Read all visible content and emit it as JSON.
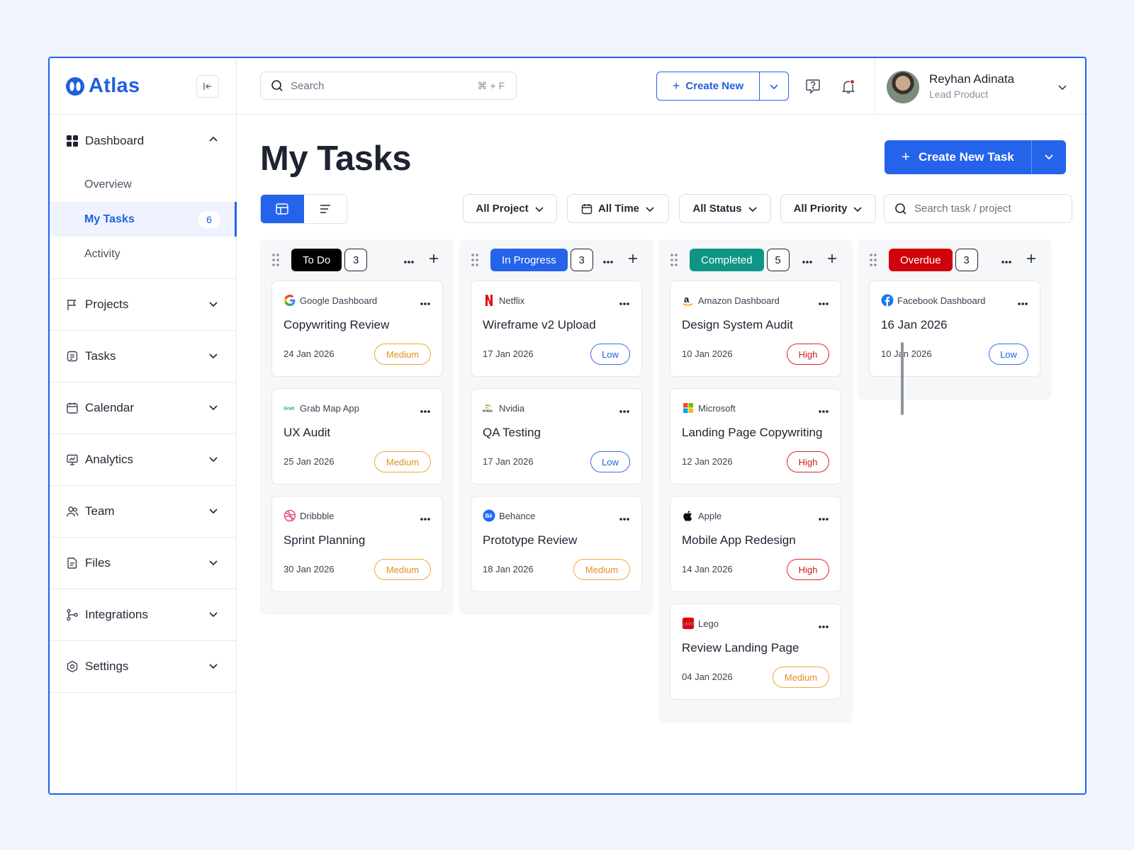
{
  "brand": {
    "name": "Atlas"
  },
  "sidebar": {
    "dashboard": {
      "label": "Dashboard",
      "subitems": [
        {
          "label": "Overview"
        },
        {
          "label": "My Tasks",
          "badge": "6"
        },
        {
          "label": "Activity"
        }
      ]
    },
    "items": [
      {
        "label": "Projects",
        "icon": "flag-icon"
      },
      {
        "label": "Tasks",
        "icon": "task-icon"
      },
      {
        "label": "Calendar",
        "icon": "calendar-icon"
      },
      {
        "label": "Analytics",
        "icon": "presentation-chart-icon"
      },
      {
        "label": "Team",
        "icon": "users-icon"
      },
      {
        "label": "Files",
        "icon": "file-icon"
      },
      {
        "label": "Integrations",
        "icon": "git-branch-icon"
      },
      {
        "label": "Settings",
        "icon": "gear-icon"
      }
    ]
  },
  "header": {
    "search_placeholder": "Search",
    "search_shortcut": "⌘ + F",
    "create_new": "Create New",
    "user": {
      "name": "Reyhan Adinata",
      "role": "Lead Product"
    }
  },
  "main": {
    "title": "My Tasks",
    "create_task": "Create New Task",
    "filters": [
      "All Project",
      "All Time",
      "All Status",
      "All Priority"
    ],
    "search_task_placeholder": "Search task / project"
  },
  "colors": {
    "accent": "#2563eb",
    "todo": "#000000",
    "in_progress": "#2563eb",
    "completed": "#0f9585",
    "overdue": "#d0020a"
  },
  "board": {
    "columns": [
      {
        "status": "To Do",
        "count": "3",
        "cards": [
          {
            "company": "Google Dashboard",
            "title": "Copywriting Review",
            "date": "24 Jan 2026",
            "priority": "Medium"
          },
          {
            "company": "Grab Map App",
            "title": "UX Audit",
            "date": "25 Jan 2026",
            "priority": "Medium"
          },
          {
            "company": "Dribbble",
            "title": "Sprint Planning",
            "date": "30 Jan 2026",
            "priority": "Medium"
          }
        ]
      },
      {
        "status": "In Progress",
        "count": "3",
        "cards": [
          {
            "company": "Netflix",
            "title": "Wireframe v2 Upload",
            "date": "17 Jan 2026",
            "priority": "Low"
          },
          {
            "company": "Nvidia",
            "title": "QA Testing",
            "date": "17 Jan 2026",
            "priority": "Low"
          },
          {
            "company": "Behance",
            "title": "Prototype Review",
            "date": "18 Jan 2026",
            "priority": "Medium"
          }
        ]
      },
      {
        "status": "Completed",
        "count": "5",
        "cards": [
          {
            "company": "Amazon Dashboard",
            "title": "Design System Audit",
            "date": "10 Jan 2026",
            "priority": "High"
          },
          {
            "company": "Microsoft",
            "title": "Landing Page Copywriting",
            "date": "12 Jan 2026",
            "priority": "High"
          },
          {
            "company": "Apple",
            "title": "Mobile App Redesign",
            "date": "14 Jan 2026",
            "priority": "High"
          },
          {
            "company": "Lego",
            "title": "Review Landing Page",
            "date": "04 Jan 2026",
            "priority": "Medium"
          }
        ]
      },
      {
        "status": "Overdue",
        "count": "3",
        "cards": [
          {
            "company": "Facebook Dashboard",
            "title": "16 Jan 2026",
            "date": "10 Jan 2026",
            "priority": "Low"
          }
        ]
      }
    ]
  }
}
